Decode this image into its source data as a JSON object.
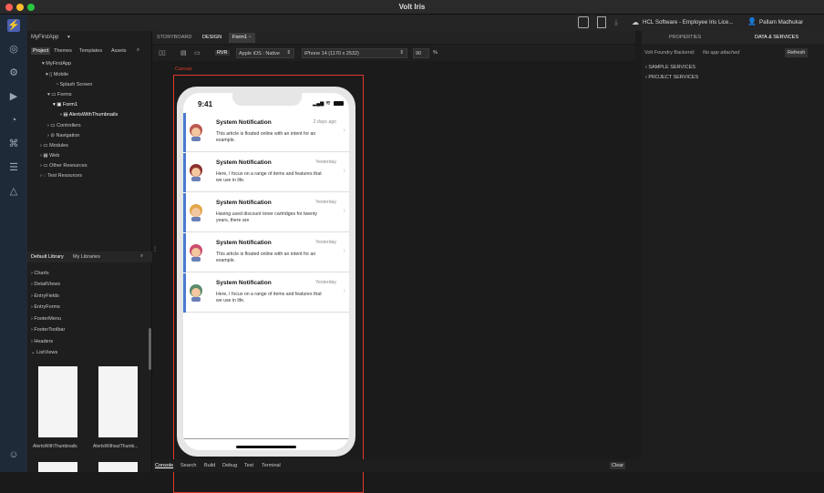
{
  "window": {
    "title": "Volt Iris"
  },
  "header": {
    "tabs": [
      "STORYBOARD",
      "DESIGN",
      "Form1"
    ],
    "platform_badge": "RVR",
    "platform_select": "Apple iOS : Native",
    "device_select": "iPhone 14 (1170 x 2532)",
    "zoom": "90",
    "zoom_unit": "%",
    "account": "HCL Software - Employee Iris Lice...",
    "user": "Pallam Madhukar"
  },
  "project": {
    "app_name": "MyFirstApp",
    "tabs": [
      "Project",
      "Themes",
      "Templates",
      "Assets"
    ],
    "tree": [
      {
        "label": "MyFirstApp"
      },
      {
        "label": "Mobile"
      },
      {
        "label": "Splash Screen"
      },
      {
        "label": "Forms"
      },
      {
        "label": "Form1"
      },
      {
        "label": "AlertsWithThumbnails"
      },
      {
        "label": "Controllers"
      },
      {
        "label": "Navigation"
      },
      {
        "label": "Modules"
      },
      {
        "label": "Web"
      },
      {
        "label": "Other Resources"
      },
      {
        "label": "Test Resources"
      }
    ]
  },
  "library": {
    "tabs": [
      "Default Library",
      "My Libraries"
    ],
    "items": [
      "Charts",
      "DetailViews",
      "EntryFields",
      "EntryForms",
      "FooterMenu",
      "FooterToolbar",
      "Headers",
      "ListViews"
    ],
    "thumbs": [
      "AlertsWithThumbnails",
      "AlertsWithoutThumb..."
    ]
  },
  "canvas": {
    "label": "Canvas",
    "time": "9:41"
  },
  "notifications": [
    {
      "title": "System Notification",
      "body": "This article is floated online with an intent for an example.",
      "time": "2 days ago",
      "avatar_color": "#b9584f"
    },
    {
      "title": "System Notification",
      "body": "Here, I focus on a range of items and features that we use in life.",
      "time": "Yesterday",
      "avatar_color": "#8c2f2f"
    },
    {
      "title": "System Notification",
      "body": "Having used discount toner cartridges for twenty years, there are",
      "time": "Yesterday",
      "avatar_color": "#e2a64a"
    },
    {
      "title": "System Notification",
      "body": "This article is floated online with an intent for an example.",
      "time": "Yesterday",
      "avatar_color": "#c94f6d"
    },
    {
      "title": "System Notification",
      "body": "Here, I focus on a range of items and features that we use in life.",
      "time": "Yesterday",
      "avatar_color": "#5a8a6a"
    }
  ],
  "right": {
    "tabs": [
      "PROPERTIES",
      "DATA & SERVICES"
    ],
    "backend_label": "Volt Foundry Backend:",
    "backend_value": "No app attached",
    "refresh": "Refresh",
    "sections": [
      "SAMPLE SERVICES",
      "PROJECT SERVICES"
    ]
  },
  "bottom_tabs": [
    "Console",
    "Search",
    "Build",
    "Debug",
    "Test",
    "Terminal"
  ],
  "clear": "Clear",
  "colors": {
    "accent": "#4a7bd0",
    "canvas_border": "#e0392b"
  }
}
